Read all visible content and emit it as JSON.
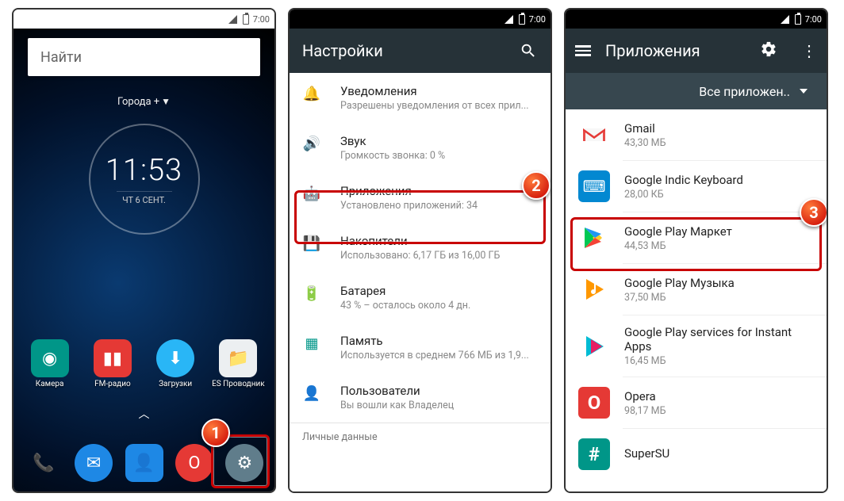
{
  "status_time": "7:00",
  "screen1": {
    "status_bg": "light",
    "search_placeholder": "Найти",
    "weather_city": "Города +",
    "clock_time": "11:53",
    "clock_date": "чт 6 сент.",
    "apps_top": [
      {
        "label": "Камера",
        "bg": "#009688",
        "glyph": "◉"
      },
      {
        "label": "FM-радио",
        "bg": "#e53935",
        "glyph": "▮▮"
      },
      {
        "label": "Загрузки",
        "bg": "#29b6f6",
        "glyph": "⬇",
        "circle": true
      },
      {
        "label": "ES Проводник",
        "bg": "#eceff1",
        "glyph": "📁"
      }
    ],
    "dock": [
      {
        "name": "phone",
        "bg": "transparent",
        "glyph": "📞",
        "color": "#1e88e5"
      },
      {
        "name": "messages",
        "bg": "#1e88e5",
        "glyph": "✉",
        "circle": true
      },
      {
        "name": "contacts",
        "bg": "#1e88e5",
        "glyph": "👤"
      },
      {
        "name": "opera",
        "bg": "#e53935",
        "glyph": "O",
        "circle": true
      },
      {
        "name": "settings",
        "bg": "#607d8b",
        "glyph": "⚙",
        "circle": true
      }
    ]
  },
  "screen2": {
    "title": "Настройки",
    "items": [
      {
        "icon": "🔔",
        "title": "Уведомления",
        "sub": "Разрешены уведомления от всех прил..."
      },
      {
        "icon": "🔊",
        "title": "Звук",
        "sub": "Громкость звонка: 0 %"
      },
      {
        "icon": "🤖",
        "title": "Приложения",
        "sub": "Установлено приложений: 34"
      },
      {
        "icon": "💾",
        "title": "Накопители",
        "sub": "Использовано: 6,17  ГБ из 16,00  ГБ"
      },
      {
        "icon": "🔋",
        "title": "Батарея",
        "sub": "43 % – осталось около 4 дн."
      },
      {
        "icon": "▦",
        "title": "Память",
        "sub": "Используется в среднем 766  МБ из 1,9..."
      },
      {
        "icon": "👤",
        "title": "Пользователи",
        "sub": "Вы вошли как Владелец"
      }
    ],
    "section_header": "Личные данные"
  },
  "screen3": {
    "title": "Приложения",
    "filter": "Все приложен..",
    "apps": [
      {
        "name": "Gmail",
        "size": "43,30  МБ",
        "bg": "#fff",
        "icon": "gmail"
      },
      {
        "name": "Google Indic Keyboard",
        "size": "28,00  КБ",
        "bg": "#0288d1",
        "icon": "keyboard"
      },
      {
        "name": "Google Play Маркет",
        "size": "44,53  МБ",
        "bg": "#fff",
        "icon": "play"
      },
      {
        "name": "Google Play Музыка",
        "size": "37,50  МБ",
        "bg": "#fff",
        "icon": "playmusic"
      },
      {
        "name": "Google Play services for Instant Apps",
        "size": "16,45  МБ",
        "bg": "#fff",
        "icon": "instant"
      },
      {
        "name": "Opera",
        "size": "98,17  МБ",
        "bg": "#e53935",
        "icon": "opera"
      },
      {
        "name": "SuperSU",
        "size": "",
        "bg": "#009688",
        "icon": "supersu"
      }
    ]
  },
  "callouts": {
    "c1": "1",
    "c2": "2",
    "c3": "3"
  }
}
